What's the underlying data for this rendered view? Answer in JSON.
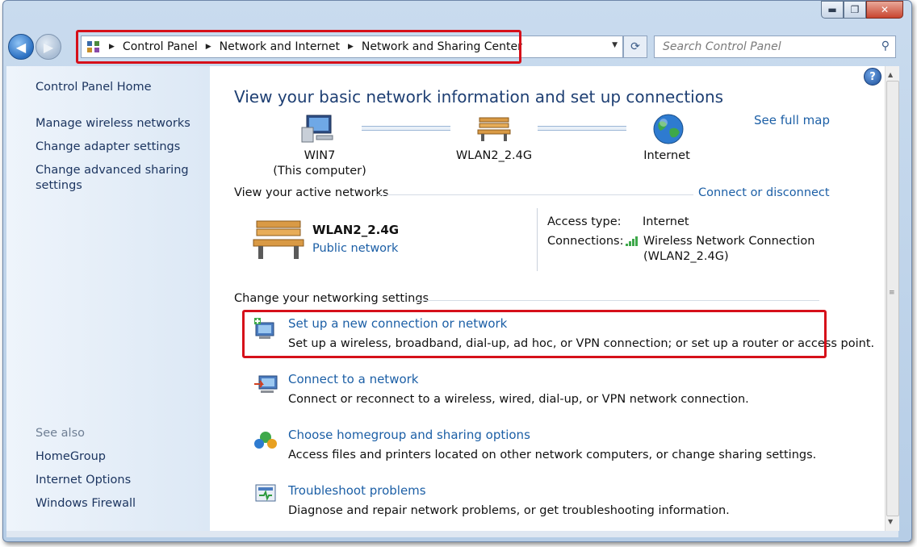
{
  "window": {
    "controls": {
      "minimize": "▬",
      "maximize": "❐",
      "close": "✕"
    }
  },
  "navigation": {
    "back_glyph": "◀",
    "forward_glyph": "▶",
    "breadcrumb": [
      "Control Panel",
      "Network and Internet",
      "Network and Sharing Center"
    ],
    "refresh_glyph": "⟳",
    "search_placeholder": "Search Control Panel"
  },
  "sidebar": {
    "home": "Control Panel Home",
    "links": [
      "Manage wireless networks",
      "Change adapter settings",
      "Change advanced sharing settings"
    ],
    "see_also_label": "See also",
    "see_also": [
      "HomeGroup",
      "Internet Options",
      "Windows Firewall"
    ]
  },
  "main": {
    "title": "View your basic network information and set up connections",
    "see_full_map": "See full map",
    "map": {
      "computer": {
        "name": "WIN7",
        "sub": "(This computer)",
        "icon": "computer-icon"
      },
      "network": {
        "name": "WLAN2_2.4G",
        "icon": "bench-icon"
      },
      "internet": {
        "name": "Internet",
        "icon": "globe-icon"
      }
    },
    "active_networks": {
      "label": "View your active networks",
      "connect_link": "Connect or disconnect",
      "network_name": "WLAN2_2.4G",
      "network_type": "Public network",
      "access_type_label": "Access type:",
      "access_type_value": "Internet",
      "connections_label": "Connections:",
      "connection_link_line1": "Wireless Network Connection",
      "connection_link_line2": "(WLAN2_2.4G)"
    },
    "settings": {
      "label": "Change your networking settings",
      "tasks": [
        {
          "title": "Set up a new connection or network",
          "desc": "Set up a wireless, broadband, dial-up, ad hoc, or VPN connection; or set up a router or access point.",
          "icon": "new-connection-icon"
        },
        {
          "title": "Connect to a network",
          "desc": "Connect or reconnect to a wireless, wired, dial-up, or VPN network connection.",
          "icon": "connect-network-icon"
        },
        {
          "title": "Choose homegroup and sharing options",
          "desc": "Access files and printers located on other network computers, or change sharing settings.",
          "icon": "homegroup-icon"
        },
        {
          "title": "Troubleshoot problems",
          "desc": "Diagnose and repair network problems, or get troubleshooting information.",
          "icon": "troubleshoot-icon"
        }
      ]
    }
  },
  "colors": {
    "highlight_box": "#d6101a",
    "link": "#1c5fa6",
    "title": "#1e3f73"
  }
}
